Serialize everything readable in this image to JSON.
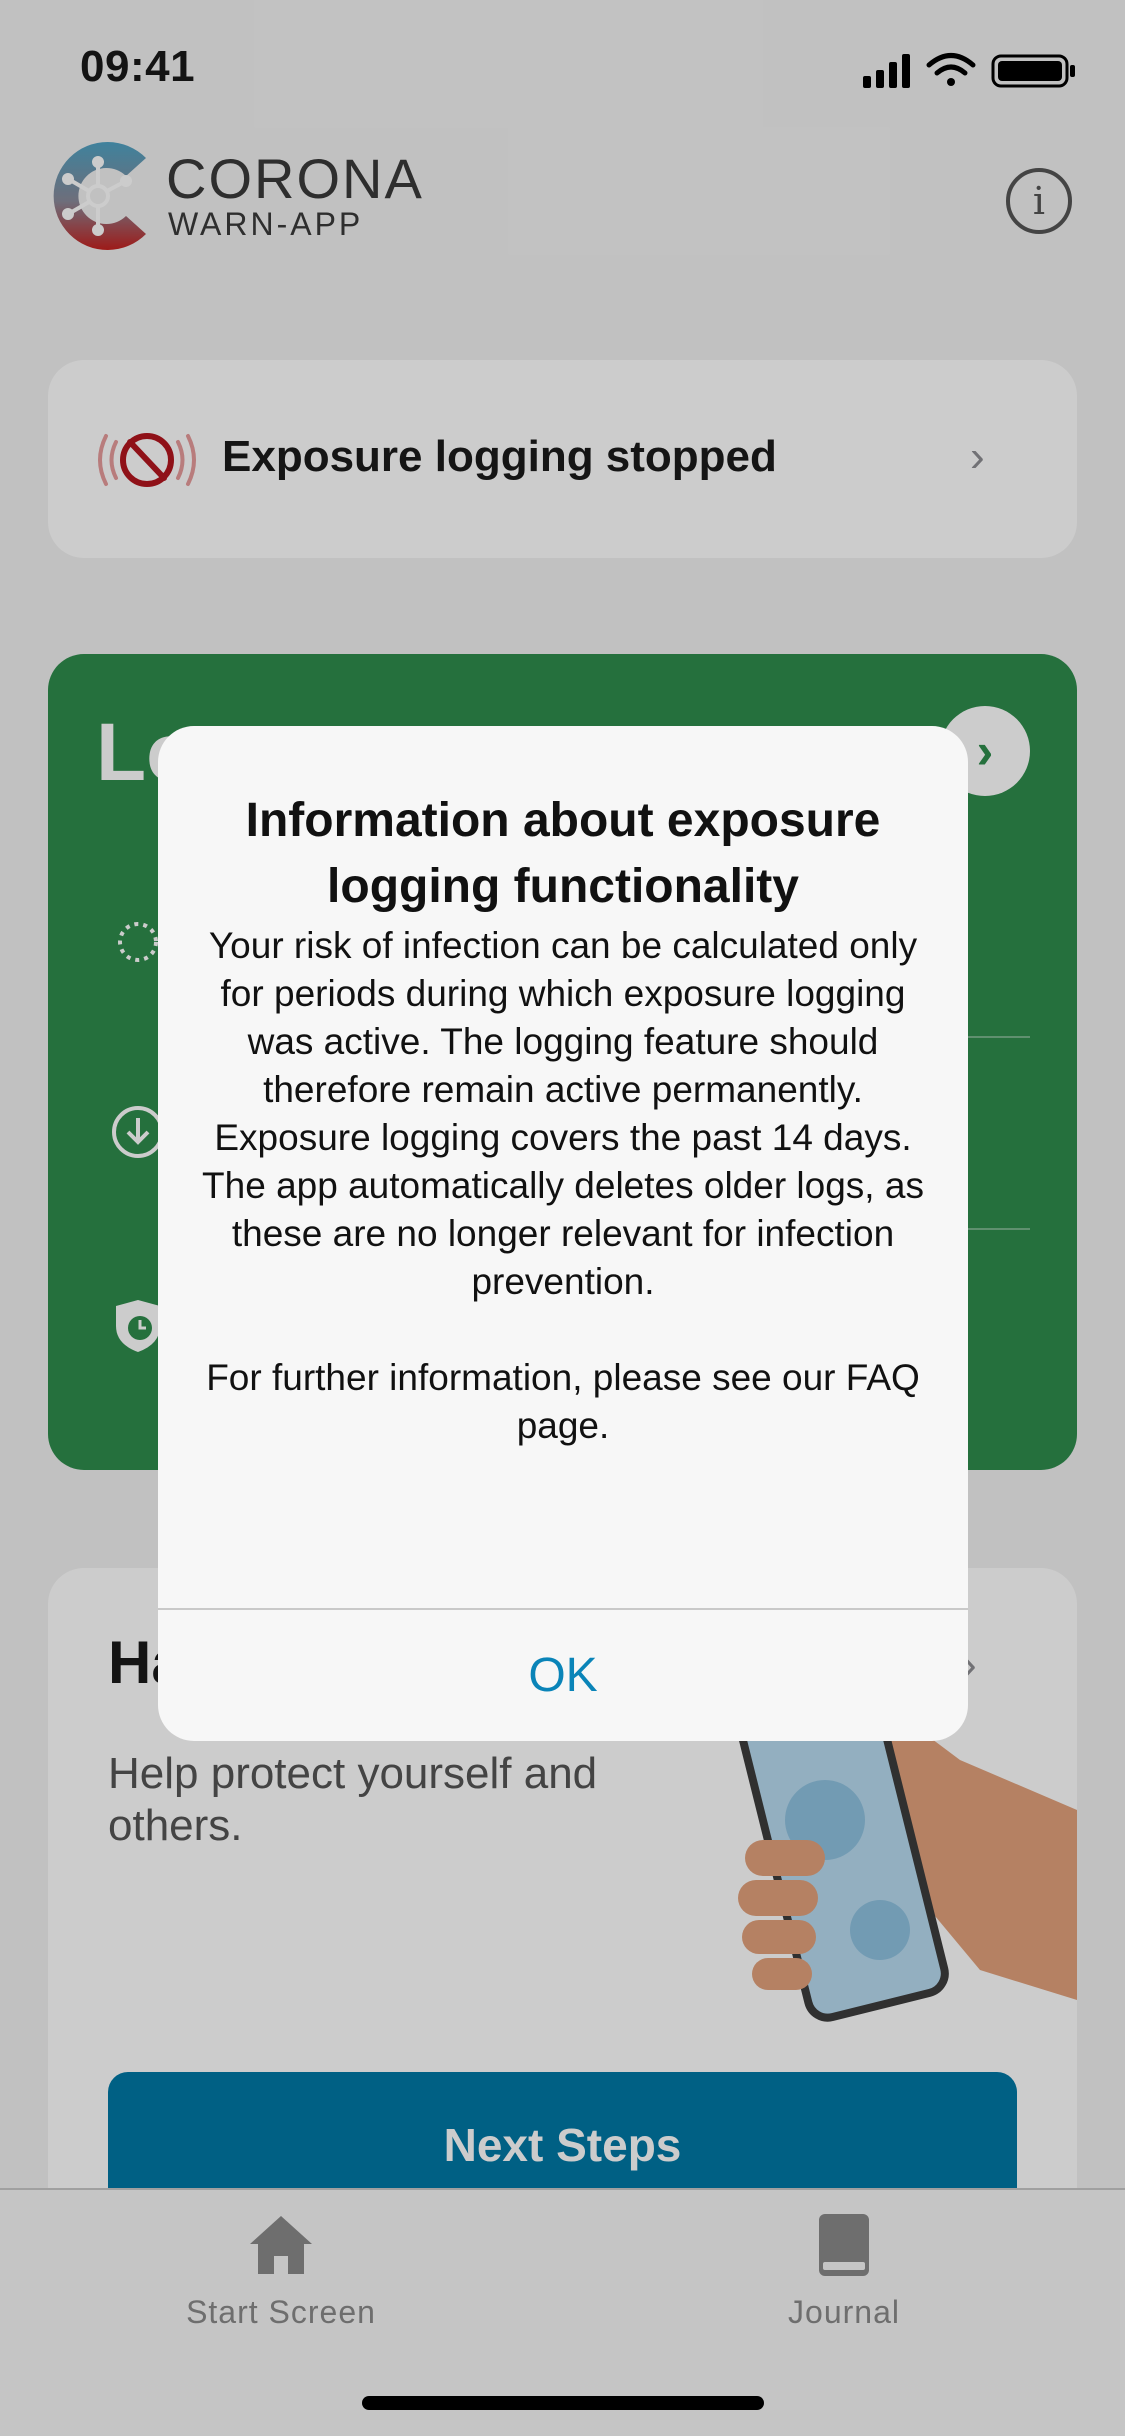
{
  "status_bar": {
    "time": "09:41"
  },
  "header": {
    "brand_line1": "CORONA",
    "brand_line2": "WARN-APP",
    "info_icon": "info-icon"
  },
  "exposure_card": {
    "label": "Exposure logging stopped",
    "icon": "exposure-off-icon"
  },
  "risk_card": {
    "title_visible": "Lo",
    "title_partial": "Low Risk",
    "color": "#2f8c4d"
  },
  "hand_card": {
    "title_visible": "Ha",
    "subtitle": "Help protect yourself and others.",
    "button_label": "Next Steps",
    "button_color": "#0078a6"
  },
  "tabs": [
    {
      "label": "Start Screen",
      "icon": "home-icon"
    },
    {
      "label": "Journal",
      "icon": "book-icon"
    }
  ],
  "alert": {
    "title": "Information about exposure logging functionality",
    "message": "Your risk of infection can be calculated only for periods during which exposure logging was active. The logging feature should therefore remain active permanently.\nExposure logging covers the past 14 days.\nThe app automatically deletes older logs, as these are no longer relevant for infection prevention.\n\nFor further information, please see our FAQ page.",
    "button": "OK",
    "accent": "#0a84b8"
  }
}
